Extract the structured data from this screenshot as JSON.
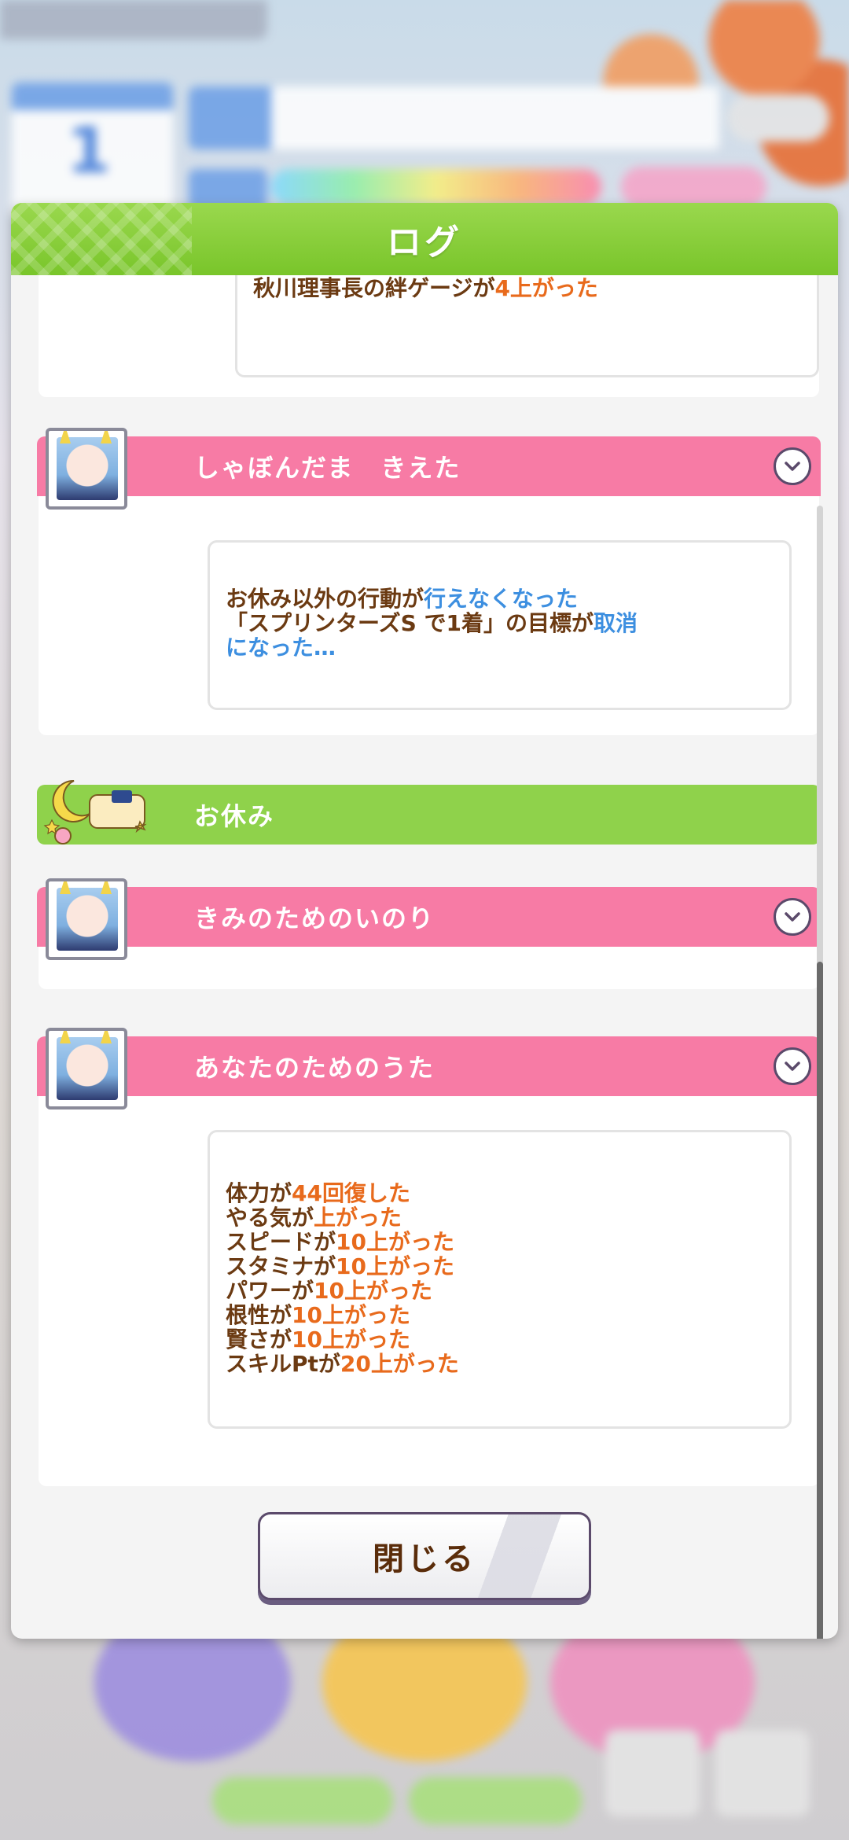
{
  "dialog": {
    "title": "ログ",
    "close_label": "閉じる"
  },
  "entries": [
    {
      "type": "partial",
      "lines": [
        [
          {
            "t": "秋川理事長の絆ゲージが",
            "c": "brown"
          },
          {
            "t": "4上がった",
            "c": "orange"
          }
        ]
      ]
    },
    {
      "type": "event",
      "title": "しゃぼんだま　きえた",
      "lines": [
        [
          {
            "t": "お休み以外の行動が",
            "c": "brown"
          },
          {
            "t": "行えなくなった",
            "c": "blue"
          }
        ],
        [
          {
            "t": "「スプリンターズS で1着」の目標が",
            "c": "brown"
          },
          {
            "t": "取消",
            "c": "blue"
          }
        ],
        [
          {
            "t": "になった…",
            "c": "blue"
          }
        ]
      ]
    },
    {
      "type": "rest",
      "title": "お休み"
    },
    {
      "type": "event",
      "title": "きみのためのいのり"
    },
    {
      "type": "event",
      "title": "あなたのためのうた",
      "lines": [
        [
          {
            "t": "体力が",
            "c": "brown"
          },
          {
            "t": "44回復した",
            "c": "orange"
          }
        ],
        [
          {
            "t": "やる気が",
            "c": "brown"
          },
          {
            "t": "上がった",
            "c": "orange"
          }
        ],
        [
          {
            "t": "スピードが",
            "c": "brown"
          },
          {
            "t": "10上がった",
            "c": "orange"
          }
        ],
        [
          {
            "t": "スタミナが",
            "c": "brown"
          },
          {
            "t": "10上がった",
            "c": "orange"
          }
        ],
        [
          {
            "t": "パワーが",
            "c": "brown"
          },
          {
            "t": "10上がった",
            "c": "orange"
          }
        ],
        [
          {
            "t": "根性が",
            "c": "brown"
          },
          {
            "t": "10上がった",
            "c": "orange"
          }
        ],
        [
          {
            "t": "賢さが",
            "c": "brown"
          },
          {
            "t": "10上がった",
            "c": "orange"
          }
        ],
        [
          {
            "t": "スキルPtが",
            "c": "brown"
          },
          {
            "t": "20上がった",
            "c": "orange"
          }
        ]
      ]
    }
  ],
  "icons": {
    "expand": "chevron-down-icon",
    "portrait": "character-portrait-icon",
    "rest": "rest-moon-pillow-icon"
  },
  "colors": {
    "header_green": "#79c52a",
    "event_pink": "#f77ba5",
    "rest_green": "#8fd24b",
    "text_brown": "#6b3a12",
    "value_orange": "#e86a1c",
    "value_blue": "#3d8fe0"
  }
}
